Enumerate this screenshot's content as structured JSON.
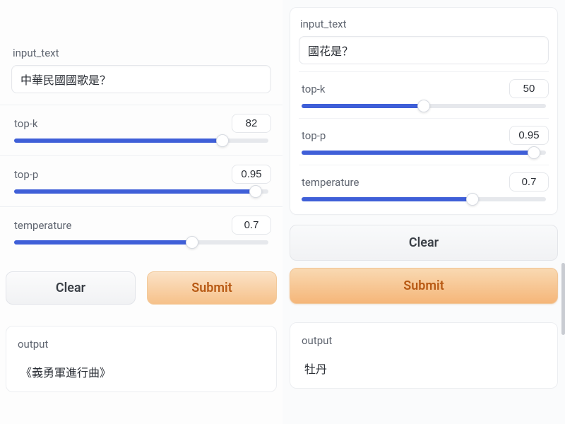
{
  "left": {
    "input_label": "input_text",
    "input_value": "中華民國國歌是？",
    "topk": {
      "label": "top-k",
      "value": "82",
      "pct": 82
    },
    "topp": {
      "label": "top-p",
      "value": "0.95",
      "pct": 95
    },
    "temp": {
      "label": "temperature",
      "value": "0.7",
      "pct": 70
    },
    "clear": "Clear",
    "submit": "Submit",
    "output_label": "output",
    "output_value": "《義勇軍進行曲》"
  },
  "right": {
    "input_label": "input_text",
    "input_value": "國花是？",
    "topk": {
      "label": "top-k",
      "value": "50",
      "pct": 50
    },
    "topp": {
      "label": "top-p",
      "value": "0.95",
      "pct": 95
    },
    "temp": {
      "label": "temperature",
      "value": "0.7",
      "pct": 70
    },
    "clear": "Clear",
    "submit": "Submit",
    "output_label": "output",
    "output_value": "牡丹"
  }
}
